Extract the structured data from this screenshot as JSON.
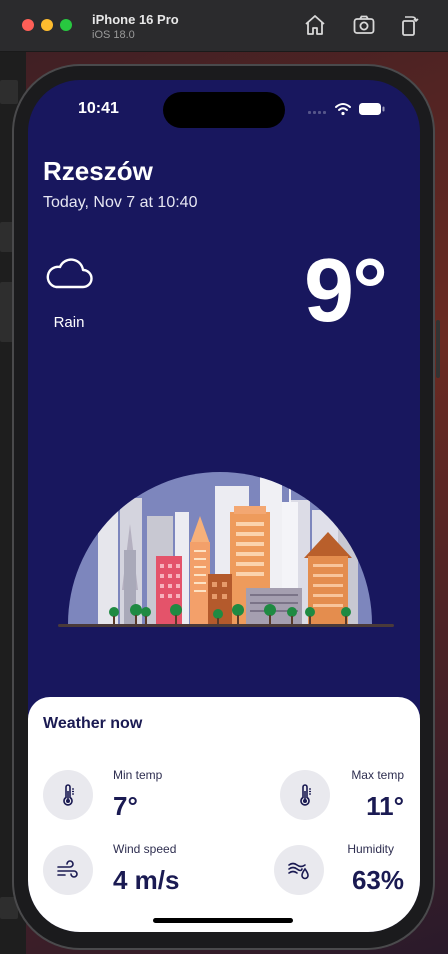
{
  "simulator": {
    "device": "iPhone 16 Pro",
    "os": "iOS 18.0",
    "buttons": [
      "home-icon",
      "screenshot-icon",
      "rotate-icon"
    ]
  },
  "status_bar": {
    "time": "10:41"
  },
  "weather": {
    "city": "Rzeszów",
    "date": "Today, Nov 7 at 10:40",
    "condition": "Rain",
    "condition_icon": "cloud-icon",
    "temperature": "9°"
  },
  "card": {
    "title": "Weather now",
    "stats": {
      "min_temp": {
        "label": "Min temp",
        "value": "7°",
        "icon": "thermometer-icon"
      },
      "max_temp": {
        "label": "Max temp",
        "value": "11°",
        "icon": "thermometer-icon"
      },
      "wind": {
        "label": "Wind speed",
        "value": "4 m/s",
        "icon": "wind-icon"
      },
      "humidity": {
        "label": "Humidity",
        "value": "63%",
        "icon": "humidity-icon"
      }
    }
  },
  "colors": {
    "screen_bg": "#18175e",
    "card_bg": "#ffffff",
    "text_dark": "#1a1a52",
    "icon_bg": "#e9e9ee"
  }
}
